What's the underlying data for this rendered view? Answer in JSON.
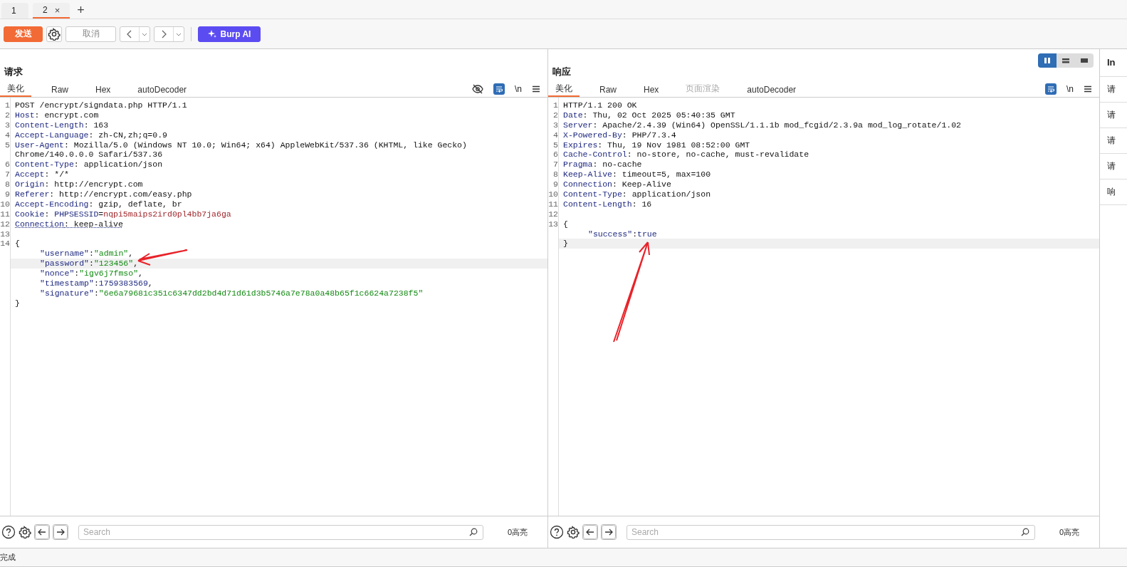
{
  "doc_tabs": [
    {
      "label": "1",
      "selected": false,
      "closable": false
    },
    {
      "label": "2",
      "selected": true,
      "closable": true,
      "close": "×"
    }
  ],
  "new_tab": "+",
  "toolbar": {
    "send": "发送",
    "cancel": "取消",
    "ai": "Burp AI"
  },
  "layout_modes": [
    {
      "kind": "split",
      "selected": true
    },
    {
      "kind": "rows",
      "selected": false
    },
    {
      "kind": "single",
      "selected": false
    }
  ],
  "request": {
    "title": "请求",
    "tabs": [
      {
        "label": "美化",
        "selected": true,
        "disabled": false
      },
      {
        "label": "Raw",
        "selected": false,
        "disabled": false
      },
      {
        "label": "Hex",
        "selected": false,
        "disabled": false
      },
      {
        "label": "autoDecoder",
        "selected": false,
        "disabled": false
      }
    ],
    "tools": [
      {
        "kind": "hide",
        "selected": false
      },
      {
        "kind": "wrap",
        "selected": true
      },
      {
        "kind": "newline",
        "label": "\\n",
        "selected": false
      },
      {
        "kind": "menu",
        "selected": false
      }
    ],
    "lines": [
      {
        "number": "1",
        "current": false,
        "segs": [
          {
            "kind": "plain",
            "text": "POST /encrypt/signdata.php HTTP/1.1"
          }
        ]
      },
      {
        "number": "2",
        "current": false,
        "segs": [
          {
            "kind": "key",
            "text": "Host"
          },
          {
            "kind": "plain",
            "text": ": encrypt.com"
          }
        ]
      },
      {
        "number": "3",
        "current": false,
        "segs": [
          {
            "kind": "key",
            "text": "Content-Length"
          },
          {
            "kind": "plain",
            "text": ": 163"
          }
        ]
      },
      {
        "number": "4",
        "current": false,
        "segs": [
          {
            "kind": "key",
            "text": "Accept-Language"
          },
          {
            "kind": "plain",
            "text": ": zh-CN,zh;q=0.9"
          }
        ]
      },
      {
        "number": "5",
        "current": false,
        "segs": [
          {
            "kind": "key",
            "text": "User-Agent"
          },
          {
            "kind": "plain",
            "text": ": Mozilla/5.0 (Windows NT 10.0; Win64; x64) AppleWebKit/537.36 (KHTML, like Gecko)"
          }
        ]
      },
      {
        "current": false,
        "segs": [
          {
            "kind": "plain",
            "text": "Chrome/140.0.0.0 Safari/537.36"
          }
        ]
      },
      {
        "number": "6",
        "current": false,
        "segs": [
          {
            "kind": "key",
            "text": "Content-Type"
          },
          {
            "kind": "plain",
            "text": ": application/json"
          }
        ]
      },
      {
        "number": "7",
        "current": false,
        "segs": [
          {
            "kind": "key",
            "text": "Accept"
          },
          {
            "kind": "plain",
            "text": ": */*"
          }
        ]
      },
      {
        "number": "8",
        "current": false,
        "segs": [
          {
            "kind": "key",
            "text": "Origin"
          },
          {
            "kind": "plain",
            "text": ": http://encrypt.com"
          }
        ]
      },
      {
        "number": "9",
        "current": false,
        "segs": [
          {
            "kind": "key",
            "text": "Referer"
          },
          {
            "kind": "plain",
            "text": ": http://encrypt.com/easy.php"
          }
        ]
      },
      {
        "number": "10",
        "current": false,
        "segs": [
          {
            "kind": "key",
            "text": "Accept-Encoding"
          },
          {
            "kind": "plain",
            "text": ": gzip, deflate, br"
          }
        ]
      },
      {
        "number": "11",
        "current": false,
        "segs": [
          {
            "kind": "key",
            "text": "Cookie"
          },
          {
            "kind": "plain",
            "text": ": "
          },
          {
            "kind": "key",
            "text": "PHPSESSID"
          },
          {
            "kind": "plain",
            "text": "="
          },
          {
            "kind": "cookie",
            "text": "nqpi5maips2ird0pl4bb7ja6ga"
          }
        ]
      },
      {
        "number": "12",
        "current": false,
        "underlined": true,
        "segs": [
          {
            "kind": "key",
            "text": "Connection"
          },
          {
            "kind": "plain",
            "text": ": keep-alive"
          }
        ]
      },
      {
        "number": "13",
        "current": false
      },
      {
        "number": "14",
        "current": false,
        "segs": [
          {
            "kind": "plain",
            "text": "{"
          }
        ]
      },
      {
        "current": false,
        "indented": true,
        "segs": [
          {
            "kind": "jkey",
            "text": "\"username\""
          },
          {
            "kind": "plain",
            "text": ":"
          },
          {
            "kind": "str",
            "text": "\"admin\""
          },
          {
            "kind": "plain",
            "text": ","
          }
        ]
      },
      {
        "current": true,
        "indented": true,
        "segs": [
          {
            "kind": "jkey",
            "text": "\"password\""
          },
          {
            "kind": "plain",
            "text": ":"
          },
          {
            "kind": "str",
            "text": "\"123456\""
          },
          {
            "kind": "plain",
            "text": ","
          }
        ]
      },
      {
        "current": false,
        "indented": true,
        "segs": [
          {
            "kind": "jkey",
            "text": "\"nonce\""
          },
          {
            "kind": "plain",
            "text": ":"
          },
          {
            "kind": "str",
            "text": "\"igv6j7fmso\""
          },
          {
            "kind": "plain",
            "text": ","
          }
        ]
      },
      {
        "current": false,
        "indented": true,
        "segs": [
          {
            "kind": "jkey",
            "text": "\"timestamp\""
          },
          {
            "kind": "plain",
            "text": ":"
          },
          {
            "kind": "num",
            "text": "1759383569"
          },
          {
            "kind": "plain",
            "text": ","
          }
        ]
      },
      {
        "current": false,
        "indented": true,
        "segs": [
          {
            "kind": "jkey",
            "text": "\"signature\""
          },
          {
            "kind": "plain",
            "text": ":"
          },
          {
            "kind": "str",
            "text": "\"6e6a79681c351c6347dd2bd4d71d61d3b5746a7e78a0a48b65f1c6624a7238f5\""
          }
        ]
      },
      {
        "current": false,
        "segs": [
          {
            "kind": "plain",
            "text": "}"
          }
        ]
      }
    ],
    "search": {
      "placeholder": "Search"
    },
    "highlights": "0高亮"
  },
  "response": {
    "title": "响应",
    "tabs": [
      {
        "label": "美化",
        "selected": true,
        "disabled": false
      },
      {
        "label": "Raw",
        "selected": false,
        "disabled": false
      },
      {
        "label": "Hex",
        "selected": false,
        "disabled": false
      },
      {
        "label": "页面渲染",
        "selected": false,
        "disabled": true
      },
      {
        "label": "autoDecoder",
        "selected": false,
        "disabled": false
      }
    ],
    "tools": [
      {
        "kind": "wrap",
        "selected": true
      },
      {
        "kind": "newline",
        "label": "\\n",
        "selected": false
      },
      {
        "kind": "menu",
        "selected": false
      }
    ],
    "lines": [
      {
        "number": "1",
        "current": false,
        "segs": [
          {
            "kind": "plain",
            "text": "HTTP/1.1 200 OK"
          }
        ]
      },
      {
        "number": "2",
        "current": false,
        "segs": [
          {
            "kind": "key",
            "text": "Date"
          },
          {
            "kind": "plain",
            "text": ": Thu, 02 Oct 2025 05:40:35 GMT"
          }
        ]
      },
      {
        "number": "3",
        "current": false,
        "segs": [
          {
            "kind": "key",
            "text": "Server"
          },
          {
            "kind": "plain",
            "text": ": Apache/2.4.39 (Win64) OpenSSL/1.1.1b mod_fcgid/2.3.9a mod_log_rotate/1.02"
          }
        ]
      },
      {
        "number": "4",
        "current": false,
        "segs": [
          {
            "kind": "key",
            "text": "X-Powered-By"
          },
          {
            "kind": "plain",
            "text": ": PHP/7.3.4"
          }
        ]
      },
      {
        "number": "5",
        "current": false,
        "segs": [
          {
            "kind": "key",
            "text": "Expires"
          },
          {
            "kind": "plain",
            "text": ": Thu, 19 Nov 1981 08:52:00 GMT"
          }
        ]
      },
      {
        "number": "6",
        "current": false,
        "segs": [
          {
            "kind": "key",
            "text": "Cache-Control"
          },
          {
            "kind": "plain",
            "text": ": no-store, no-cache, must-revalidate"
          }
        ]
      },
      {
        "number": "7",
        "current": false,
        "segs": [
          {
            "kind": "key",
            "text": "Pragma"
          },
          {
            "kind": "plain",
            "text": ": no-cache"
          }
        ]
      },
      {
        "number": "8",
        "current": false,
        "segs": [
          {
            "kind": "key",
            "text": "Keep-Alive"
          },
          {
            "kind": "plain",
            "text": ": timeout=5, max=100"
          }
        ]
      },
      {
        "number": "9",
        "current": false,
        "segs": [
          {
            "kind": "key",
            "text": "Connection"
          },
          {
            "kind": "plain",
            "text": ": Keep-Alive"
          }
        ]
      },
      {
        "number": "10",
        "current": false,
        "segs": [
          {
            "kind": "key",
            "text": "Content-Type"
          },
          {
            "kind": "plain",
            "text": ": application/json"
          }
        ]
      },
      {
        "number": "11",
        "current": false,
        "segs": [
          {
            "kind": "key",
            "text": "Content-Length"
          },
          {
            "kind": "plain",
            "text": ": 16"
          }
        ]
      },
      {
        "number": "12",
        "current": false
      },
      {
        "number": "13",
        "current": false,
        "segs": [
          {
            "kind": "plain",
            "text": "{"
          }
        ]
      },
      {
        "current": false,
        "indented": true,
        "segs": [
          {
            "kind": "jkey",
            "text": "\"success\""
          },
          {
            "kind": "plain",
            "text": ":"
          },
          {
            "kind": "kw",
            "text": "true"
          }
        ]
      },
      {
        "current": true,
        "segs": [
          {
            "kind": "plain",
            "text": "}"
          }
        ]
      }
    ],
    "search": {
      "placeholder": "Search"
    },
    "highlights": "0高亮"
  },
  "sidebar": {
    "title": "In",
    "items": [
      "请",
      "请",
      "请",
      "请",
      "响"
    ]
  },
  "status_bar": "完成"
}
